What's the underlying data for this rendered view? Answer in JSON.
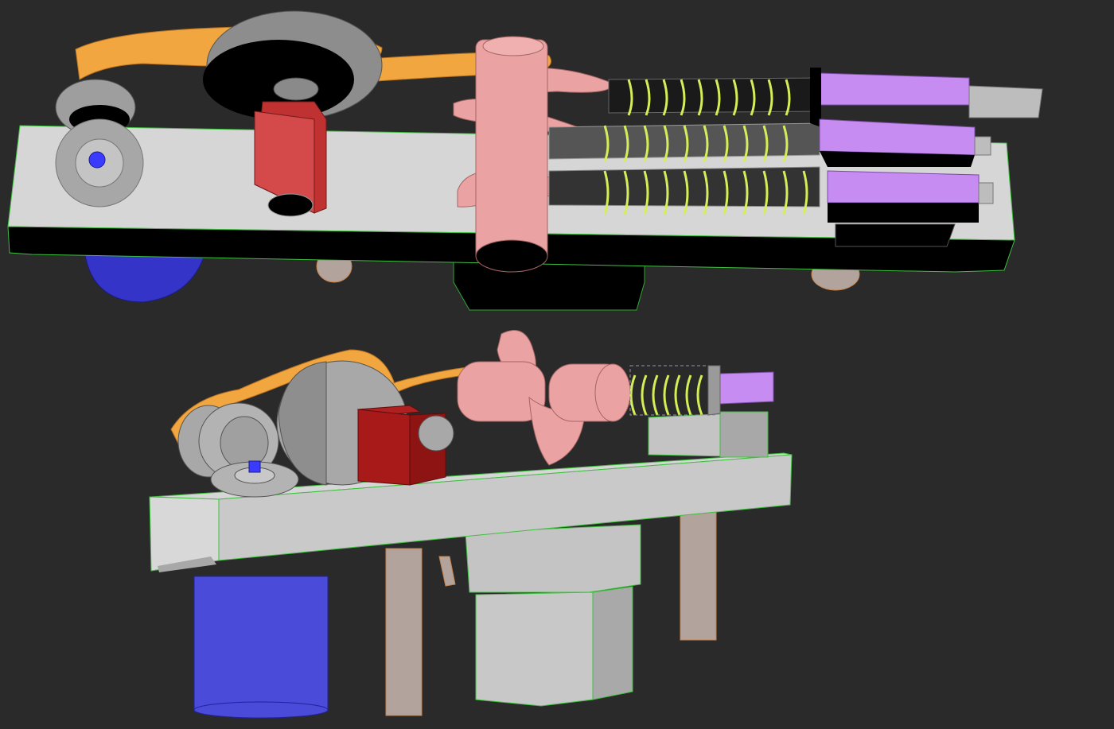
{
  "scene": {
    "background": "#2a2a2a",
    "views": [
      {
        "name": "top-view"
      },
      {
        "name": "perspective-view"
      }
    ]
  },
  "colors": {
    "frame": "#d6d6d6",
    "frame_shadow": "#000000",
    "frame_edge": "#3fbf3f",
    "belt": "#f2a640",
    "belt_edge": "#b8711f",
    "pulley": "#9a9a9a",
    "gear": "#a7a7a7",
    "motor_block": "#d24040",
    "motor_block_dark": "#8e1414",
    "crankshaft": "#eba2a2",
    "spring": "#d4ee5a",
    "piston": "#c78cf2",
    "rod": "#bdbdbd",
    "drive_motor": "#4b4bd9",
    "leg": "#b2a49c"
  }
}
